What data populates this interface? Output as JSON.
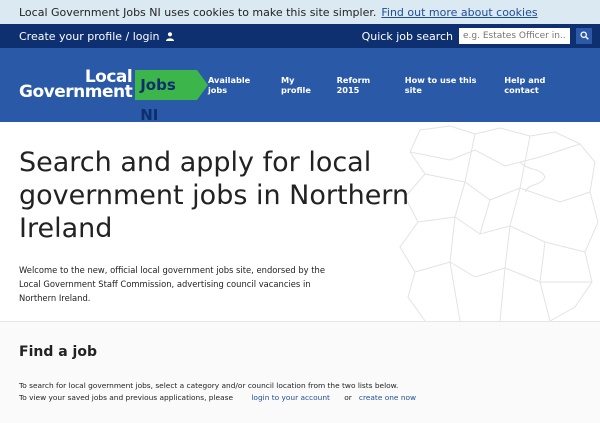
{
  "cookie": {
    "message": "Local Government Jobs NI uses cookies to make this site simpler.",
    "link": "Find out more about cookies"
  },
  "utility": {
    "profile_label": "Create your profile / login",
    "quick_search_label": "Quick job search",
    "search_placeholder": "e.g. Estates Officer in..."
  },
  "logo": {
    "line1": "Local",
    "line2": "Government",
    "badge": "Jobs NI"
  },
  "nav": {
    "items": [
      "Available jobs",
      "My profile",
      "Reform 2015",
      "How to use this site",
      "Help and contact"
    ]
  },
  "hero": {
    "title": "Search and apply for local government jobs in Northern Ireland",
    "intro": "Welcome to the new, official local government jobs site, endorsed by the Local Government Staff Commission, advertising council vacancies in Northern Ireland."
  },
  "find": {
    "heading": "Find a job",
    "line1": "To search for local government jobs, select a category and/or council location from the two lists below.",
    "line2_prefix": "To view your saved jobs and previous applications, please",
    "login_link": "login to your account",
    "or": "or",
    "create_link": "create one now"
  },
  "colors": {
    "header_blue": "#2a5aa7",
    "utility_navy": "#0f3070",
    "logo_green": "#3cb54a",
    "cookie_bg": "#dbe9f3"
  }
}
